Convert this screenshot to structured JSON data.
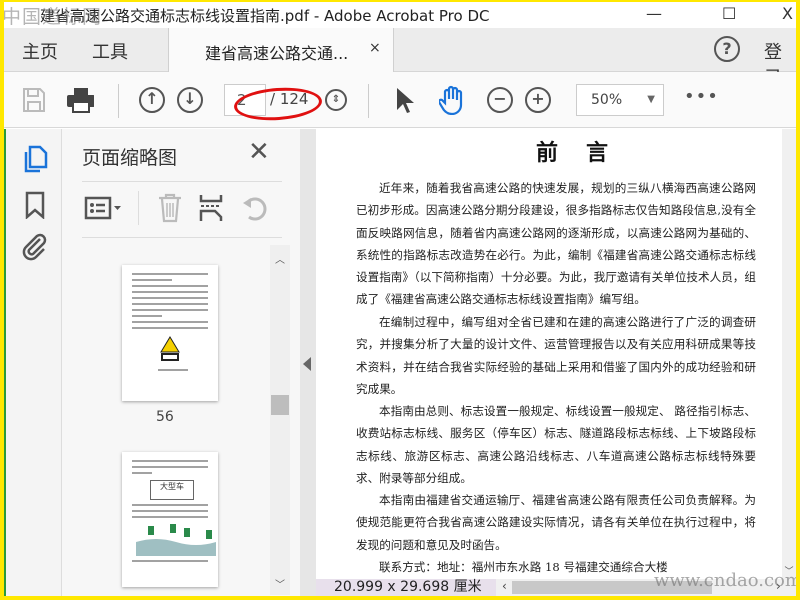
{
  "window": {
    "title": "建省高速公路交通标志标线设置指南.pdf - Adobe Acrobat Pro DC",
    "watermark": "中国道标网",
    "minimize": "—",
    "maximize": "☐",
    "close": "X"
  },
  "tabs": {
    "home": "主页",
    "tools": "工具",
    "document_tab": "建省高速公路交通...",
    "document_tab_close": "×",
    "help": "?",
    "login": "登录"
  },
  "toolbar": {
    "current_page": "2",
    "total_pages": "/ 124",
    "zoom": "50%",
    "more": "•••"
  },
  "sidebar": {
    "panel_title": "页面缩略图",
    "close": "✕",
    "thumbnails": [
      {
        "page_label": "56"
      },
      {
        "page_label": ""
      }
    ]
  },
  "document": {
    "heading": "前言",
    "paragraphs": [
      "近年来，随着我省高速公路的快速发展，规划的三纵八横海西高速公路网已初步形成。因高速公路分期分段建设，很多指路标志仅告知路段信息,没有全面反映路网信息，随着省内高速公路网的逐渐形成，以高速公路网为基础的、系统性的指路标志改造势在必行。为此，编制《福建省高速公路交通标志标线设置指南》（以下简称指南）十分必要。为此，我厅邀请有关单位技术人员，组成了《福建省高速公路交通标志标线设置指南》编写组。",
      "在编制过程中，编写组对全省已建和在建的高速公路进行了广泛的调查研究，并搜集分析了大量的设计文件、运营管理报告以及有关应用科研成果等技术资料，并在结合我省实际经验的基础上采用和借鉴了国内外的成功经验和研究成果。",
      "本指南由总则、标志设置一般规定、标线设置一般规定、 路径指引标志、收费站标志标线、服务区（停车区）标志、隧道路段标志标线、上下坡路段标志标线、旅游区标志、高速公路沿线标志、八车道高速公路标志标线特殊要求、附录等部分组成。",
      "本指南由福建省交通运输厅、福建省高速公路有限责任公司负责解释。为使规范能更符合我省高速公路建设实际情况，请各有关单位在执行过程中，将发现的问题和意见及时函告。",
      "联系方式：地址：福州市东水路 18 号福建交通综合大楼"
    ]
  },
  "status": {
    "page_size": "20.999 x 29.698 厘米",
    "watermark": "www.cndao.com"
  },
  "colors": {
    "accent": "#1a73d9",
    "highlight_ellipse": "#e01010",
    "frame": "#ffe800"
  }
}
